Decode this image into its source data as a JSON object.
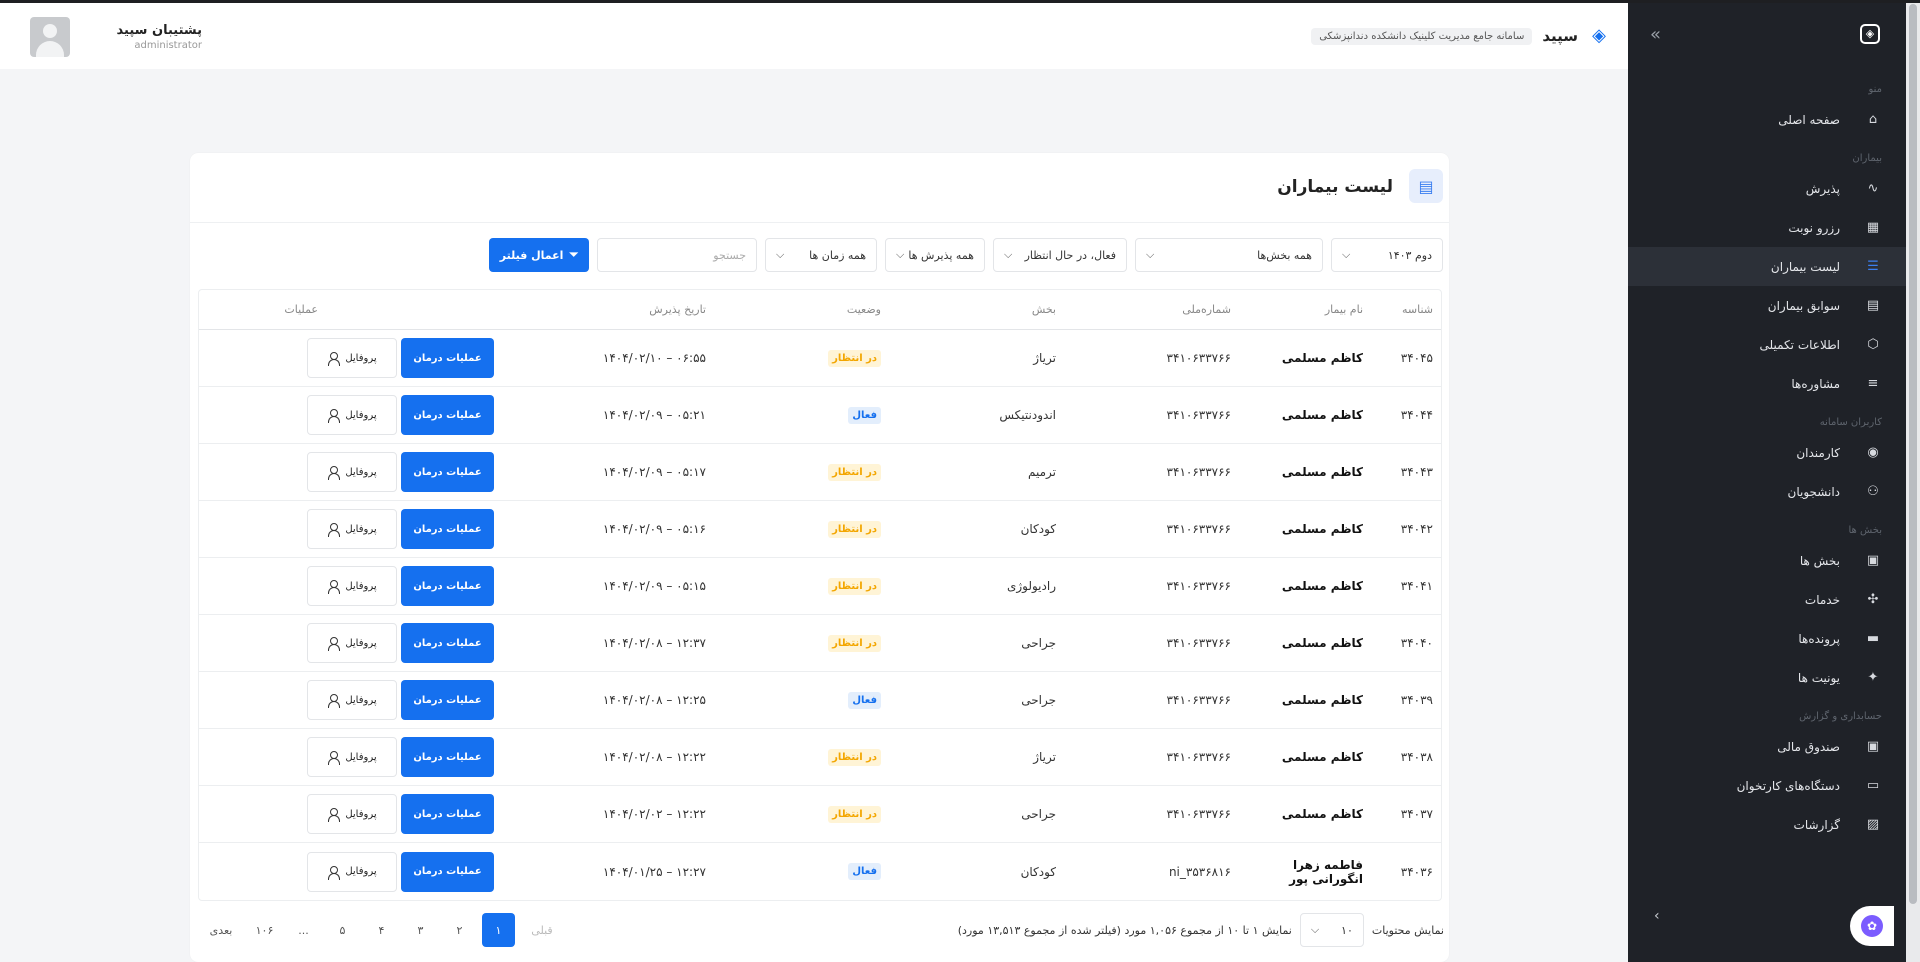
{
  "header": {
    "brand_name": "سپید",
    "brand_subtitle": "سامانه جامع مدیریت کلینیک دانشکده دندانپزشکی",
    "user_name": "پشتیبان سپید",
    "user_role": "administrator"
  },
  "sidebar": {
    "sections": [
      {
        "title": "منو",
        "items": [
          {
            "label": "صفحه اصلی",
            "icon": "home-icon",
            "active": false
          }
        ]
      },
      {
        "title": "بیماران",
        "items": [
          {
            "label": "پذیرش",
            "icon": "pulse-icon",
            "active": false
          },
          {
            "label": "رزرو نوبت",
            "icon": "calendar-icon",
            "active": false
          },
          {
            "label": "لیست بیماران",
            "icon": "list-icon",
            "active": true
          },
          {
            "label": "سوابق بیماران",
            "icon": "document-icon",
            "active": false
          },
          {
            "label": "اطلاعات تکمیلی",
            "icon": "cube-icon",
            "active": false
          },
          {
            "label": "مشاوره‌ها",
            "icon": "chat-icon",
            "active": false
          }
        ]
      },
      {
        "title": "کاربران سامانه",
        "items": [
          {
            "label": "کارمندان",
            "icon": "user-circle-icon",
            "active": false
          },
          {
            "label": "دانشجویان",
            "icon": "users-icon",
            "active": false
          }
        ]
      },
      {
        "title": "بخش ها",
        "items": [
          {
            "label": "بخش ها",
            "icon": "grid-icon",
            "active": false
          },
          {
            "label": "خدمات",
            "icon": "tools-icon",
            "active": false
          },
          {
            "label": "پرونده‌ها",
            "icon": "folder-icon",
            "active": false
          },
          {
            "label": "یونیت ها",
            "icon": "sparkle-icon",
            "active": false
          }
        ]
      },
      {
        "title": "حسابداری و گزارش",
        "items": [
          {
            "label": "صندوق مالی",
            "icon": "safe-icon",
            "active": false
          },
          {
            "label": "دستگاه‌های کارتخوان",
            "icon": "card-icon",
            "active": false
          },
          {
            "label": "گزارشات",
            "icon": "chart-icon",
            "active": false
          }
        ]
      }
    ]
  },
  "card": {
    "title": "لیست بیماران"
  },
  "filters": {
    "term": "دوم ۱۴۰۳",
    "ward": "همه بخش‌ها",
    "status": "فعال، در حال انتظار",
    "admission": "همه پذیرش ها",
    "time": "همه زمان ها",
    "search_placeholder": "جستجو",
    "apply_label": "اعمال فیلتر"
  },
  "table": {
    "columns": [
      "شناسه",
      "نام بیمار",
      "شماره‌ملی",
      "بخش",
      "وضعیت",
      "تاریخ پذیرش",
      "عملیات"
    ],
    "ops_label": "عملیات درمان",
    "profile_label": "پروفایل",
    "rows": [
      {
        "id": "۳۴۰۴۵",
        "name": "کاظم مسلمی",
        "national": "۳۴۱۰۶۳۳۷۶۶",
        "ward": "تریاژ",
        "status": "در انتظار",
        "status_type": "wait",
        "date": "۱۴۰۴/۰۲/۱۰ – ۰۶:۵۵"
      },
      {
        "id": "۳۴۰۴۴",
        "name": "کاظم مسلمی",
        "national": "۳۴۱۰۶۳۳۷۶۶",
        "ward": "اندودنتیکس",
        "status": "فعال",
        "status_type": "active",
        "date": "۱۴۰۴/۰۲/۰۹ – ۰۵:۲۱"
      },
      {
        "id": "۳۴۰۴۳",
        "name": "کاظم مسلمی",
        "national": "۳۴۱۰۶۳۳۷۶۶",
        "ward": "ترمیم",
        "status": "در انتظار",
        "status_type": "wait",
        "date": "۱۴۰۴/۰۲/۰۹ – ۰۵:۱۷"
      },
      {
        "id": "۳۴۰۴۲",
        "name": "کاظم مسلمی",
        "national": "۳۴۱۰۶۳۳۷۶۶",
        "ward": "کودکان",
        "status": "در انتظار",
        "status_type": "wait",
        "date": "۱۴۰۴/۰۲/۰۹ – ۰۵:۱۶"
      },
      {
        "id": "۳۴۰۴۱",
        "name": "کاظم مسلمی",
        "national": "۳۴۱۰۶۳۳۷۶۶",
        "ward": "رادیولوژی",
        "status": "در انتظار",
        "status_type": "wait",
        "date": "۱۴۰۴/۰۲/۰۹ – ۰۵:۱۵"
      },
      {
        "id": "۳۴۰۴۰",
        "name": "کاظم مسلمی",
        "national": "۳۴۱۰۶۳۳۷۶۶",
        "ward": "جراحی",
        "status": "در انتظار",
        "status_type": "wait",
        "date": "۱۴۰۴/۰۲/۰۸ – ۱۲:۳۷"
      },
      {
        "id": "۳۴۰۳۹",
        "name": "کاظم مسلمی",
        "national": "۳۴۱۰۶۳۳۷۶۶",
        "ward": "جراحی",
        "status": "فعال",
        "status_type": "active",
        "date": "۱۴۰۴/۰۲/۰۸ – ۱۲:۲۵"
      },
      {
        "id": "۳۴۰۳۸",
        "name": "کاظم مسلمی",
        "national": "۳۴۱۰۶۳۳۷۶۶",
        "ward": "تریاژ",
        "status": "در انتظار",
        "status_type": "wait",
        "date": "۱۴۰۴/۰۲/۰۸ – ۱۲:۲۲"
      },
      {
        "id": "۳۴۰۳۷",
        "name": "کاظم مسلمی",
        "national": "۳۴۱۰۶۳۳۷۶۶",
        "ward": "جراحی",
        "status": "در انتظار",
        "status_type": "wait",
        "date": "۱۴۰۴/۰۲/۰۲ – ۱۲:۲۲"
      },
      {
        "id": "۳۴۰۳۶",
        "name": "فاطمه زهرا انگورانی پور",
        "national": "ni_۳۵۳۶۸۱۶",
        "ward": "کودکان",
        "status": "فعال",
        "status_type": "active",
        "date": "۱۴۰۴/۰۱/۲۵ – ۱۲:۲۷"
      }
    ]
  },
  "footer": {
    "page_size_label": "نمایش محتویات",
    "page_size": "۱۰",
    "info": "نمایش ۱ تا ۱۰ از مجموع ۱,۰۵۶ مورد (فیلتر شده از مجموع ۱۳,۵۱۳ مورد)",
    "prev": "قبلی",
    "next": "بعدی",
    "pages": [
      "۱",
      "۲",
      "۳",
      "۴",
      "۵",
      "...",
      "۱۰۶"
    ],
    "current_page": "۱"
  }
}
